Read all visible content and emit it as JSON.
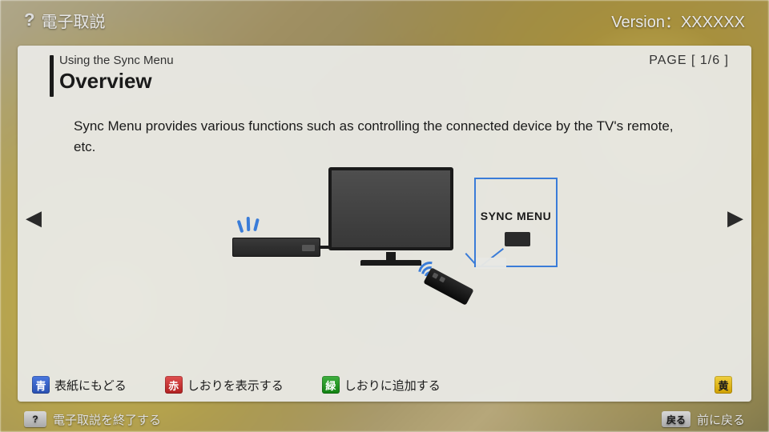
{
  "header": {
    "help_icon": "?",
    "app_title": "電子取説",
    "version_label": "Version：XXXXXX"
  },
  "card": {
    "breadcrumb": "Using the Sync Menu",
    "title": "Overview",
    "page_indicator": "PAGE  [ 1/6 ]",
    "description": "Sync Menu provides various functions such as controlling the connected device by the TV's remote, etc."
  },
  "diagram": {
    "callout_label": "SYNC MENU"
  },
  "legend": {
    "blue": {
      "chip": "青",
      "label": "表紙にもどる"
    },
    "red": {
      "chip": "赤",
      "label": "しおりを表示する"
    },
    "green": {
      "chip": "緑",
      "label": "しおりに追加する"
    },
    "yellow": {
      "chip": "黄"
    }
  },
  "footer": {
    "help_key": "?",
    "exit_label": "電子取説を終了する",
    "back_key": "戻る",
    "back_label": "前に戻る"
  }
}
